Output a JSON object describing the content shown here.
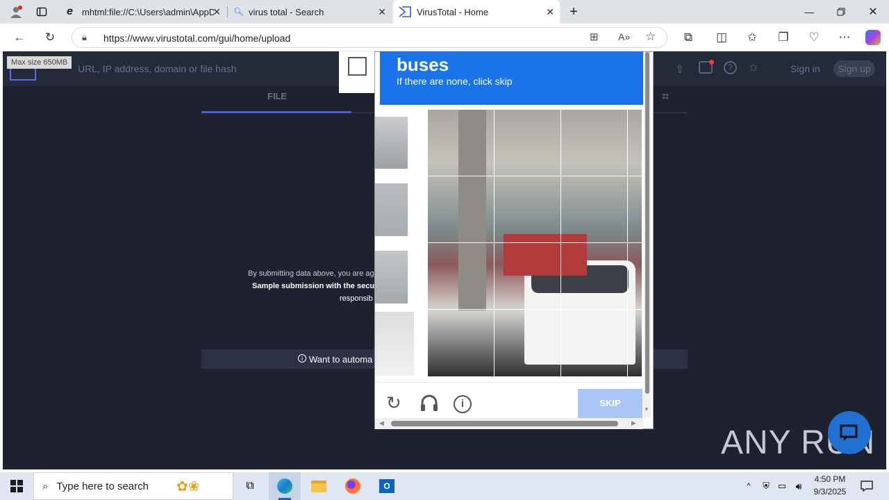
{
  "browser": {
    "tabs": [
      {
        "title": "mhtml:file://C:\\Users\\admin\\AppD"
      },
      {
        "title": "virus total - Search"
      },
      {
        "title": "VirusTotal - Home"
      }
    ],
    "url": "https://www.virustotal.com/gui/home/upload"
  },
  "vt": {
    "tooltip": "Max size 650MB",
    "search_placeholder": "URL, IP address, domain or file hash",
    "signin": "Sign in",
    "signup": "Sign up",
    "tab_file": "FILE",
    "terms_line1": "By submitting data above, you are ag",
    "terms_line2": "Sample submission with the secu",
    "terms_line3": "responsib",
    "automate": "Want to automa"
  },
  "captcha": {
    "object": "buses",
    "instruction": "If there are none, click skip",
    "skip_label": "SKIP"
  },
  "watermark": "ANY RUN",
  "taskbar": {
    "search_placeholder": "Type here to search",
    "time": "4:50 PM",
    "date": "9/3/2025"
  },
  "colors": {
    "captcha_blue": "#1a73e8",
    "vt_bg": "#1e2130",
    "skip_bg": "#a8c5f3"
  }
}
